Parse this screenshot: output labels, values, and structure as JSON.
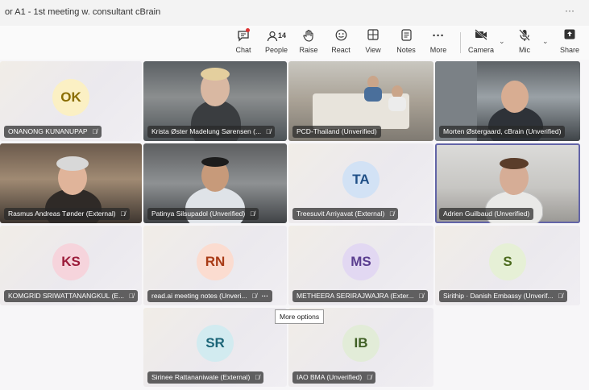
{
  "window": {
    "title": "or A1 - 1st meeting w. consultant cBrain",
    "more": "···"
  },
  "toolbar": {
    "chat": {
      "label": "Chat",
      "icon": "chat-icon"
    },
    "people": {
      "label": "People",
      "count": "14",
      "icon": "people-icon"
    },
    "raise": {
      "label": "Raise",
      "icon": "hand-icon"
    },
    "react": {
      "label": "React",
      "icon": "smile-icon"
    },
    "view": {
      "label": "View",
      "icon": "grid-icon"
    },
    "notes": {
      "label": "Notes",
      "icon": "notes-icon"
    },
    "more": {
      "label": "More",
      "glyph": "···"
    },
    "camera": {
      "label": "Camera",
      "icon": "camera-off-icon"
    },
    "mic": {
      "label": "Mic",
      "icon": "mic-off-icon"
    },
    "share": {
      "label": "Share",
      "icon": "share-icon"
    }
  },
  "participants": [
    {
      "name": "ONANONG KUNANUPAP",
      "initials": "OK",
      "muted": true
    },
    {
      "name": "Krista Øster Madelung Sørensen (...",
      "muted": true
    },
    {
      "name": "PCD-Thailand (Unverified)",
      "muted": false
    },
    {
      "name": "Morten Østergaard, cBrain (Unverified)",
      "muted": false
    },
    {
      "name": "Rasmus Andreas Tønder (External)",
      "muted": true
    },
    {
      "name": "Patinya Silsupadol (Unverified)",
      "muted": true
    },
    {
      "name": "Treesuvit Arriyavat (External)",
      "initials": "TA",
      "muted": true
    },
    {
      "name": "Adrien Guilbaud (Unverified)",
      "muted": false,
      "active": true
    },
    {
      "name": "KOMGRID SRIWATTANANGKUL (E...",
      "initials": "KS",
      "muted": true
    },
    {
      "name": "read.ai meeting notes (Unveri...",
      "initials": "RN",
      "muted": true,
      "more": "···"
    },
    {
      "name": "METHEERA SERIRAJWAJRA (Exter...",
      "initials": "MS",
      "muted": true
    },
    {
      "name": "Sirithip · Danish Embassy (Unverif...",
      "initials": "S",
      "muted": true
    },
    {
      "name": "Sirinee Rattananiwate (External)",
      "initials": "SR",
      "muted": true
    },
    {
      "name": "IAO BMA (Unverified)",
      "initials": "IB",
      "muted": true
    }
  ],
  "tooltip": "More options",
  "colors": {
    "OK": {
      "bg": "#fbf0c4",
      "fg": "#8a6d00"
    },
    "TA": {
      "bg": "#d2e2f5",
      "fg": "#1f4f86"
    },
    "KS": {
      "bg": "#f6d4dc",
      "fg": "#9b1c3a"
    },
    "RN": {
      "bg": "#fbdcd0",
      "fg": "#a83a15"
    },
    "MS": {
      "bg": "#e2d8f2",
      "fg": "#5a3d8f"
    },
    "S": {
      "bg": "#e6f0d6",
      "fg": "#4c6b1e"
    },
    "SR": {
      "bg": "#d2ebf0",
      "fg": "#1b6577"
    },
    "IB": {
      "bg": "#e2ecd8",
      "fg": "#3f5f24"
    }
  }
}
